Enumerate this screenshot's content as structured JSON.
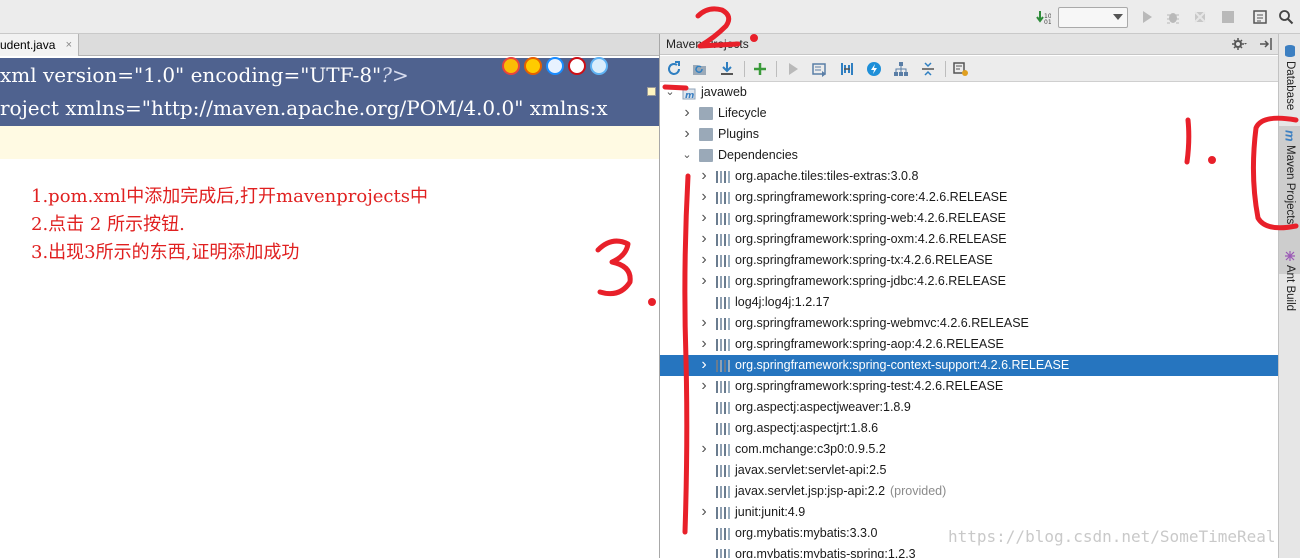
{
  "toolbar": {
    "run_config_value": "",
    "icons": [
      "vcs-update-icon",
      "run-icon",
      "debug-icon",
      "coverage-icon",
      "stop-icon",
      "project-structure-icon",
      "search-icon"
    ]
  },
  "editor": {
    "tab_label": "udent.java",
    "tab_close": "×",
    "code_lines": [
      {
        "pre": "xml version=\"1.0\" encoding=\"UTF-8\"",
        "post": "?>"
      },
      {
        "pre": "roject xmlns=\"http://maven.apache.org/POM/4.0.0\" xmlns:x",
        "post": ""
      }
    ],
    "notes": [
      "1.pom.xml中添加完成后,打开mavenprojects中",
      "2.点击 2 所示按钮.",
      "3.出现3所示的东西,证明添加成功"
    ]
  },
  "maven": {
    "title": "Maven Projects",
    "header_icons": [
      "gear-icon",
      "hide-panel-icon"
    ],
    "toolbar_icons": [
      "reimport-icon",
      "generate-sources-icon",
      "download-icon",
      "add-icon",
      "run-maven-build-icon",
      "execute-goal-icon",
      "toggle-offline-icon",
      "skip-tests-icon",
      "show-dependencies-icon",
      "collapse-all-icon",
      "settings-icon"
    ],
    "tree": [
      {
        "label": "javaweb",
        "depth": 0,
        "expander": "open",
        "icon": "maven-module-icon"
      },
      {
        "label": "Lifecycle",
        "depth": 1,
        "expander": "closed",
        "icon": "folder-icon"
      },
      {
        "label": "Plugins",
        "depth": 1,
        "expander": "closed",
        "icon": "folder-icon"
      },
      {
        "label": "Dependencies",
        "depth": 1,
        "expander": "open",
        "icon": "folder-icon"
      },
      {
        "label": "org.apache.tiles:tiles-extras:3.0.8",
        "depth": 2,
        "expander": "closed",
        "icon": "library-icon"
      },
      {
        "label": "org.springframework:spring-core:4.2.6.RELEASE",
        "depth": 2,
        "expander": "closed",
        "icon": "library-icon"
      },
      {
        "label": "org.springframework:spring-web:4.2.6.RELEASE",
        "depth": 2,
        "expander": "closed",
        "icon": "library-icon"
      },
      {
        "label": "org.springframework:spring-oxm:4.2.6.RELEASE",
        "depth": 2,
        "expander": "closed",
        "icon": "library-icon"
      },
      {
        "label": "org.springframework:spring-tx:4.2.6.RELEASE",
        "depth": 2,
        "expander": "closed",
        "icon": "library-icon"
      },
      {
        "label": "org.springframework:spring-jdbc:4.2.6.RELEASE",
        "depth": 2,
        "expander": "closed",
        "icon": "library-icon"
      },
      {
        "label": "log4j:log4j:1.2.17",
        "depth": 2,
        "expander": "none",
        "icon": "library-icon"
      },
      {
        "label": "org.springframework:spring-webmvc:4.2.6.RELEASE",
        "depth": 2,
        "expander": "closed",
        "icon": "library-icon"
      },
      {
        "label": "org.springframework:spring-aop:4.2.6.RELEASE",
        "depth": 2,
        "expander": "closed",
        "icon": "library-icon"
      },
      {
        "label": "org.springframework:spring-context-support:4.2.6.RELEASE",
        "depth": 2,
        "expander": "closed",
        "icon": "library-icon",
        "selected": true
      },
      {
        "label": "org.springframework:spring-test:4.2.6.RELEASE",
        "depth": 2,
        "expander": "closed",
        "icon": "library-icon"
      },
      {
        "label": "org.aspectj:aspectjweaver:1.8.9",
        "depth": 2,
        "expander": "none",
        "icon": "library-icon"
      },
      {
        "label": "org.aspectj:aspectjrt:1.8.6",
        "depth": 2,
        "expander": "none",
        "icon": "library-icon"
      },
      {
        "label": "com.mchange:c3p0:0.9.5.2",
        "depth": 2,
        "expander": "closed",
        "icon": "library-icon"
      },
      {
        "label": "javax.servlet:servlet-api:2.5",
        "depth": 2,
        "expander": "none",
        "icon": "library-icon"
      },
      {
        "label": "javax.servlet.jsp:jsp-api:2.2",
        "scope": "(provided)",
        "depth": 2,
        "expander": "none",
        "icon": "library-icon"
      },
      {
        "label": "junit:junit:4.9",
        "depth": 2,
        "expander": "closed",
        "icon": "library-icon"
      },
      {
        "label": "org.mybatis:mybatis:3.3.0",
        "depth": 2,
        "expander": "none",
        "icon": "library-icon"
      },
      {
        "label": "org.mybatis:mybatis-spring:1.2.3",
        "depth": 2,
        "expander": "none",
        "icon": "library-icon"
      }
    ]
  },
  "side_tabs": [
    {
      "label": "Database",
      "icon": "database-icon",
      "active": false
    },
    {
      "label": "Maven Projects",
      "icon": "maven-icon",
      "active": true
    },
    {
      "label": "Ant Build",
      "icon": "ant-icon",
      "active": false
    }
  ],
  "annotations": {
    "marks": [
      "2.",
      "1.",
      "3."
    ],
    "color": "#e8202a"
  },
  "watermark": "https://blog.csdn.net/SomeTimeReal",
  "colors": {
    "selection": "#2675bf",
    "code_highlight": "#4f628f",
    "note_text": "#e02020"
  }
}
